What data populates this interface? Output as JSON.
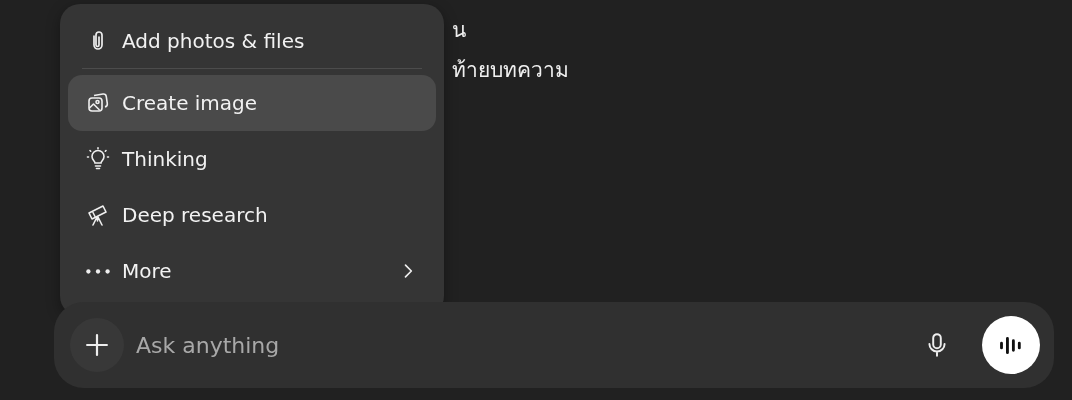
{
  "background_text": [
    "น",
    "ท้ายบทความ"
  ],
  "menu": {
    "items": [
      {
        "kind": "attach",
        "label": "Add photos & files",
        "selected": false,
        "divider_after": true,
        "submenu": false
      },
      {
        "kind": "image",
        "label": "Create image",
        "selected": true,
        "divider_after": false,
        "submenu": false
      },
      {
        "kind": "thinking",
        "label": "Thinking",
        "selected": false,
        "divider_after": false,
        "submenu": false
      },
      {
        "kind": "research",
        "label": "Deep research",
        "selected": false,
        "divider_after": false,
        "submenu": false
      },
      {
        "kind": "more",
        "label": "More",
        "selected": false,
        "divider_after": false,
        "submenu": true
      }
    ]
  },
  "composer": {
    "placeholder": "Ask anything"
  }
}
